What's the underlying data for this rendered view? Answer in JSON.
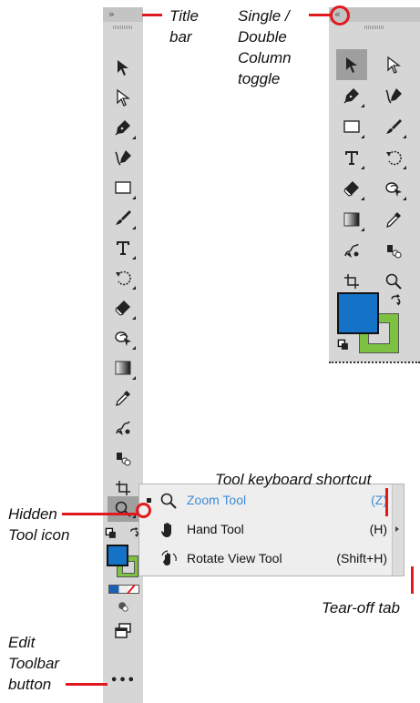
{
  "callouts": {
    "title_bar": [
      "Title",
      "bar"
    ],
    "column_toggle": [
      "Single /",
      "Double",
      "Column",
      "toggle"
    ],
    "keyboard_shortcut": "Tool keyboard shortcut",
    "hidden_tool": [
      "Hidden",
      "Tool icon"
    ],
    "tear_off": "Tear-off tab",
    "edit_toolbar": [
      "Edit",
      "Toolbar",
      "button"
    ]
  },
  "toolbar_single": {
    "collapse_glyph": "››",
    "tools": [
      "selection-arrow-icon",
      "direct-selection-icon",
      "pen-icon",
      "curvature-icon",
      "rectangle-icon",
      "paintbrush-icon",
      "type-icon",
      "rotate-icon",
      "eraser-icon",
      "shape-builder-icon",
      "gradient-icon",
      "eyedropper-icon",
      "blend-icon",
      "symbol-sprayer-icon",
      "artboard-icon",
      "zoom-icon"
    ],
    "fill_color": "#1473c6",
    "stroke_color": "#7cc142",
    "more_label": "•••"
  },
  "toolbar_double": {
    "expand_glyph": "‹‹",
    "fill_color": "#1473c6",
    "stroke_color": "#7cc142"
  },
  "flyout": {
    "items": [
      {
        "name": "Zoom Tool",
        "shortcut": "(Z)",
        "active": true
      },
      {
        "name": "Hand Tool",
        "shortcut": "(H)",
        "active": false
      },
      {
        "name": "Rotate View Tool",
        "shortcut": "(Shift+H)",
        "active": false
      }
    ]
  },
  "colors": {
    "accent": "#e1191e",
    "active_text": "#3d8ad6"
  }
}
